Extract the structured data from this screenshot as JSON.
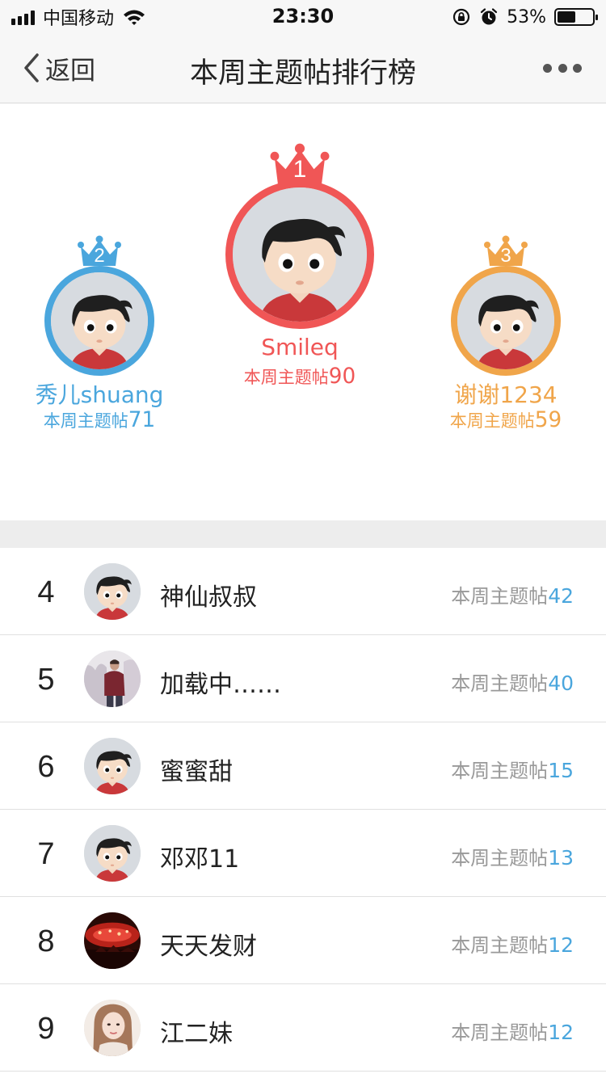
{
  "status_bar": {
    "carrier": "中国移动",
    "time": "23:30",
    "battery_percent": "53%",
    "battery_level": 0.53,
    "icons": [
      "signal-icon",
      "wifi-icon",
      "rotation-lock-icon",
      "alarm-icon",
      "battery-icon"
    ]
  },
  "nav": {
    "back_label": "返回",
    "title": "本周主题帖排行榜",
    "more_icon": "more-dots-icon"
  },
  "colors": {
    "first": "#f05656",
    "second": "#4aa6dd",
    "third": "#f0a54a",
    "count_accent": "#4aa6dd"
  },
  "podium": {
    "first": {
      "rank": "1",
      "name": "Smileq",
      "count_label": "本周主题帖",
      "count": "90"
    },
    "second": {
      "rank": "2",
      "name": "秀儿shuang",
      "count_label": "本周主题帖",
      "count": "71"
    },
    "third": {
      "rank": "3",
      "name": "谢谢1234",
      "count_label": "本周主题帖",
      "count": "59"
    }
  },
  "ranking": [
    {
      "rank": "4",
      "name": "神仙叔叔",
      "count_label": "本周主题帖",
      "count": "42",
      "avatar": "cartoon-boy"
    },
    {
      "rank": "5",
      "name": "加载中……",
      "count_label": "本周主题帖",
      "count": "40",
      "avatar": "photo-person-snow"
    },
    {
      "rank": "6",
      "name": "蜜蜜甜",
      "count_label": "本周主题帖",
      "count": "15",
      "avatar": "cartoon-boy"
    },
    {
      "rank": "7",
      "name": "邓邓11",
      "count_label": "本周主题帖",
      "count": "13",
      "avatar": "cartoon-boy"
    },
    {
      "rank": "8",
      "name": "天天发财",
      "count_label": "本周主题帖",
      "count": "12",
      "avatar": "photo-red-lights"
    },
    {
      "rank": "9",
      "name": "江二妹",
      "count_label": "本周主题帖",
      "count": "12",
      "avatar": "photo-woman"
    }
  ]
}
